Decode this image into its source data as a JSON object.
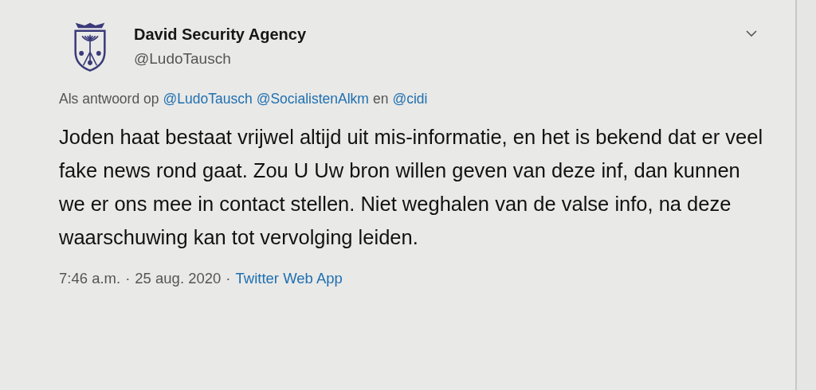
{
  "tweet": {
    "author": {
      "name": "David Security Agency",
      "handle": "@LudoTausch"
    },
    "reply": {
      "prefix": "Als antwoord op",
      "mentions": [
        "@LudoTausch",
        "@SocialistenAlkm"
      ],
      "conjunction": "en",
      "last_mention": "@cidi"
    },
    "text": "Joden haat bestaat vrijwel altijd uit mis-informatie, en het is bekend dat er veel fake news rond gaat. Zou U Uw bron willen geven van deze inf, dan kunnen we er ons mee in contact stellen. Niet weghalen van de valse info, na deze waarschuwing kan tot vervolging leiden.",
    "time": "7:46 a.m.",
    "separator": "·",
    "date": "25 aug. 2020",
    "source": "Twitter Web App"
  }
}
